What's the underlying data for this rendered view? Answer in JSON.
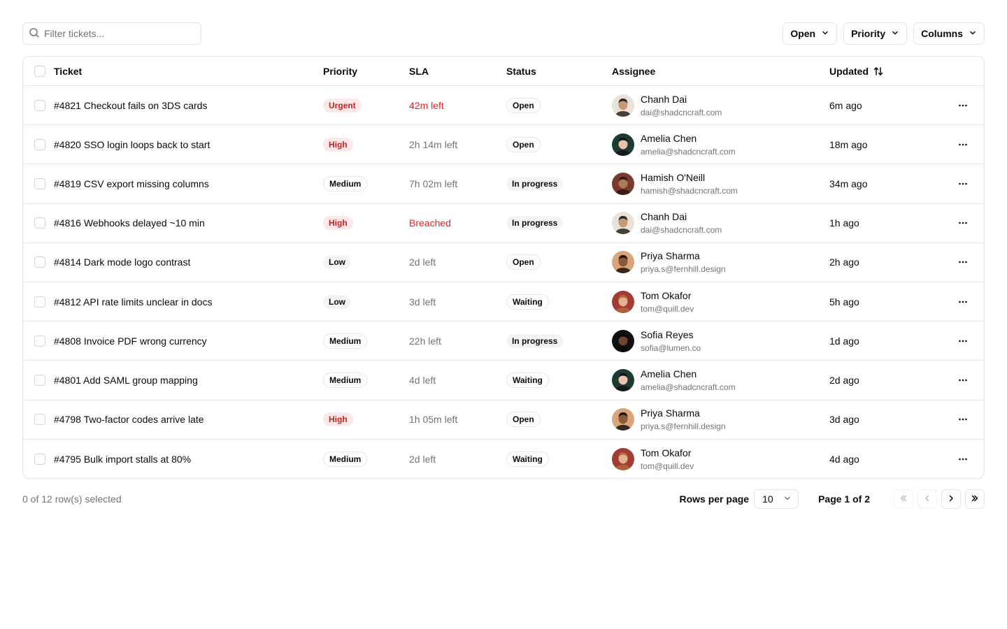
{
  "search": {
    "placeholder": "Filter tickets..."
  },
  "filters": [
    {
      "label": "Open"
    },
    {
      "label": "Priority"
    },
    {
      "label": "Columns"
    }
  ],
  "columns": {
    "ticket": "Ticket",
    "priority": "Priority",
    "sla": "SLA",
    "status": "Status",
    "assignee": "Assignee",
    "updated": "Updated"
  },
  "rows": [
    {
      "ticket": "#4821 Checkout fails on 3DS cards",
      "priority": "Urgent",
      "sla": "42m left",
      "sla_danger": true,
      "status": "Open",
      "assignee": {
        "name": "Chanh Dai",
        "email": "dai@shadcncraft.com"
      },
      "updated": "6m ago"
    },
    {
      "ticket": "#4820 SSO login loops back to start",
      "priority": "High",
      "sla": "2h 14m left",
      "sla_danger": false,
      "status": "Open",
      "assignee": {
        "name": "Amelia Chen",
        "email": "amelia@shadcncraft.com"
      },
      "updated": "18m ago"
    },
    {
      "ticket": "#4819 CSV export missing columns",
      "priority": "Medium",
      "sla": "7h 02m left",
      "sla_danger": false,
      "status": "In progress",
      "assignee": {
        "name": "Hamish O'Neill",
        "email": "hamish@shadcncraft.com"
      },
      "updated": "34m ago"
    },
    {
      "ticket": "#4816 Webhooks delayed ~10 min",
      "priority": "High",
      "sla": "Breached",
      "sla_danger": true,
      "status": "In progress",
      "assignee": {
        "name": "Chanh Dai",
        "email": "dai@shadcncraft.com"
      },
      "updated": "1h ago"
    },
    {
      "ticket": "#4814 Dark mode logo contrast",
      "priority": "Low",
      "sla": "2d left",
      "sla_danger": false,
      "status": "Open",
      "assignee": {
        "name": "Priya Sharma",
        "email": "priya.s@fernhill.design"
      },
      "updated": "2h ago"
    },
    {
      "ticket": "#4812 API rate limits unclear in docs",
      "priority": "Low",
      "sla": "3d left",
      "sla_danger": false,
      "status": "Waiting",
      "assignee": {
        "name": "Tom Okafor",
        "email": "tom@quill.dev"
      },
      "updated": "5h ago"
    },
    {
      "ticket": "#4808 Invoice PDF wrong currency",
      "priority": "Medium",
      "sla": "22h left",
      "sla_danger": false,
      "status": "In progress",
      "assignee": {
        "name": "Sofia Reyes",
        "email": "sofia@lumen.co"
      },
      "updated": "1d ago"
    },
    {
      "ticket": "#4801 Add SAML group mapping",
      "priority": "Medium",
      "sla": "4d left",
      "sla_danger": false,
      "status": "Waiting",
      "assignee": {
        "name": "Amelia Chen",
        "email": "amelia@shadcncraft.com"
      },
      "updated": "2d ago"
    },
    {
      "ticket": "#4798 Two-factor codes arrive late",
      "priority": "High",
      "sla": "1h 05m left",
      "sla_danger": false,
      "status": "Open",
      "assignee": {
        "name": "Priya Sharma",
        "email": "priya.s@fernhill.design"
      },
      "updated": "3d ago"
    },
    {
      "ticket": "#4795 Bulk import stalls at 80%",
      "priority": "Medium",
      "sla": "2d left",
      "sla_danger": false,
      "status": "Waiting",
      "assignee": {
        "name": "Tom Okafor",
        "email": "tom@quill.dev"
      },
      "updated": "4d ago"
    }
  ],
  "footer": {
    "selected": "0 of 12 row(s) selected",
    "rows_per_page_label": "Rows per page",
    "rows_per_page_value": "10",
    "page_label": "Page 1 of 2"
  },
  "colors": {
    "danger": "#dc2626",
    "badge_red_bg": "#fde8e8",
    "badge_red_text": "#c81e1e",
    "muted": "#737373",
    "border": "#e4e4e7"
  },
  "avatars": {
    "Chanh Dai": {
      "bg": "#e8e2d8",
      "skin": "#c89a74",
      "hair": "#2a2420"
    },
    "Amelia Chen": {
      "bg": "#1f3a34",
      "skin": "#e8c3a6",
      "hair": "#151515"
    },
    "Hamish O'Neill": {
      "bg": "#7a3a2e",
      "skin": "#b07a5a",
      "hair": "#2b1a14"
    },
    "Priya Sharma": {
      "bg": "#d9a47a",
      "skin": "#8a5a3c",
      "hair": "#1b120e"
    },
    "Tom Okafor": {
      "bg": "#a23a36",
      "skin": "#e3b090",
      "hair": "#b06a3c"
    },
    "Sofia Reyes": {
      "bg": "#111111",
      "skin": "#6e4630",
      "hair": "#0b0b0b"
    }
  }
}
